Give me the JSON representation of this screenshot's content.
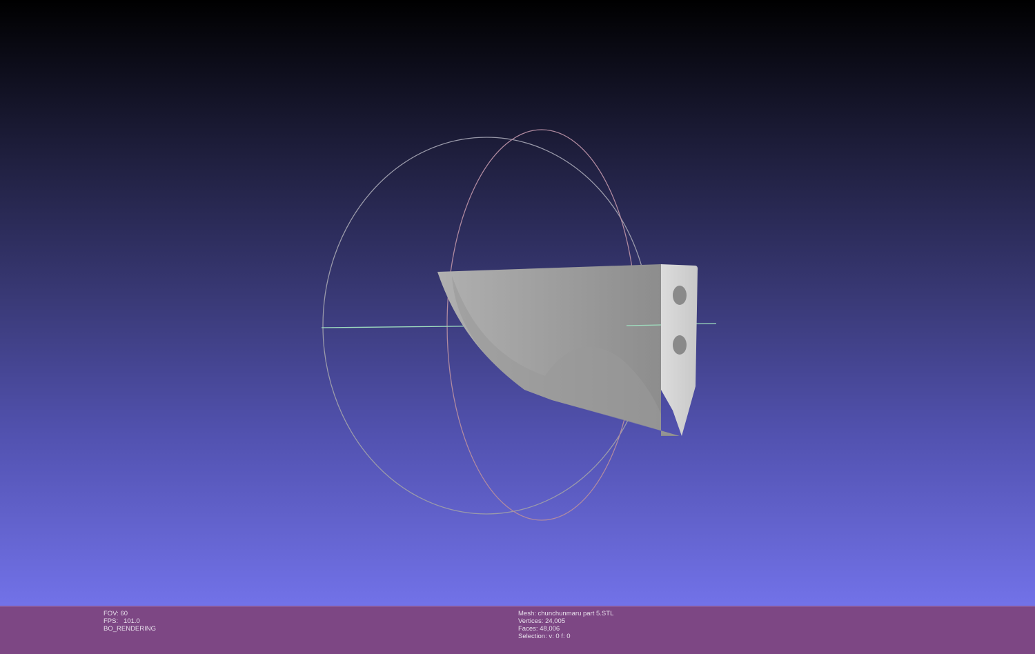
{
  "status_left": {
    "fov": "FOV: 60",
    "fps": "FPS:   101.0",
    "mode": "BO_RENDERING"
  },
  "status_right": {
    "mesh": "Mesh: chunchunmaru part 5.STL",
    "vertices": "Vertices: 24,005",
    "faces": "Faces: 48,006",
    "selection": "Selection: v: 0 f: 0"
  }
}
